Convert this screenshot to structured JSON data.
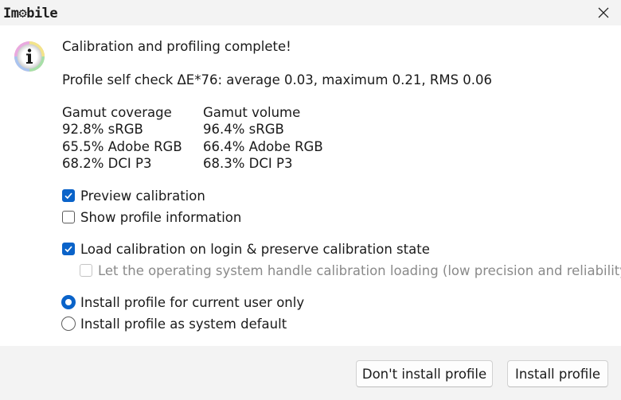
{
  "titlebar": {
    "logo_text": "Im⚙bile",
    "close_icon": "close-icon"
  },
  "dialog": {
    "icon": "info-icon",
    "heading": "Calibration and profiling complete!",
    "self_check": "Profile self check ΔE*76: average 0.03, maximum 0.21, RMS 0.06",
    "gamut_coverage": {
      "title": "Gamut coverage",
      "rows": [
        "92.8% sRGB",
        "65.5% Adobe RGB",
        "68.2% DCI P3"
      ]
    },
    "gamut_volume": {
      "title": "Gamut volume",
      "rows": [
        "96.4% sRGB",
        "66.4% Adobe RGB",
        "68.3% DCI P3"
      ]
    },
    "options": {
      "preview_calibration": "Preview calibration",
      "show_profile_info": "Show profile information",
      "load_calibration": "Load calibration on login & preserve calibration state",
      "os_handle": "Let the operating system handle calibration loading (low precision and reliability)",
      "install_current_user": "Install profile for current user only",
      "install_system_default": "Install profile as system default"
    },
    "states": {
      "preview_calibration": true,
      "show_profile_info": false,
      "load_calibration": true,
      "os_handle": false,
      "install_scope": "current_user"
    }
  },
  "footer": {
    "dont_install_label": "Don't install profile",
    "install_label": "Install profile"
  },
  "colors": {
    "accent": "#0a63c9",
    "titlebar_bg": "#f3f3f3",
    "footer_bg": "#f3f3f3"
  }
}
